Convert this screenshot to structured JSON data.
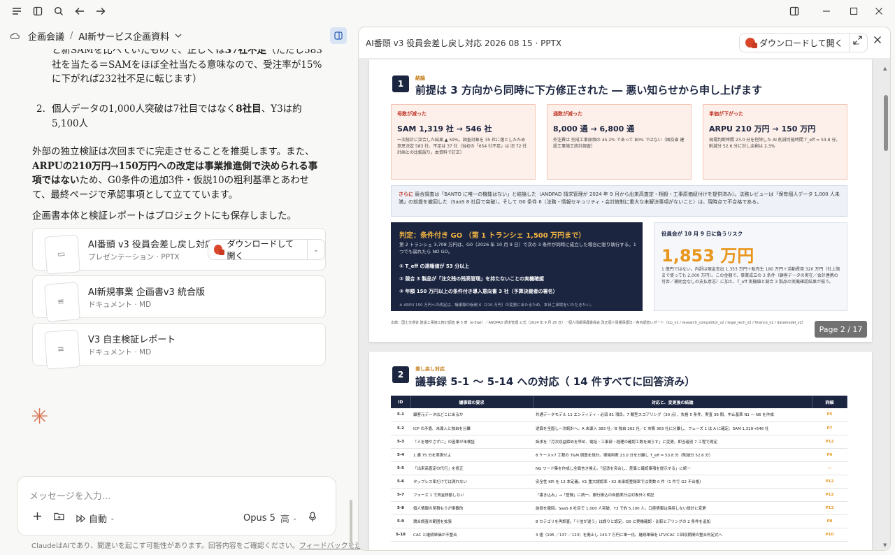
{
  "header": {
    "project": "企画会議",
    "conversation": "AI新サービス企画資料"
  },
  "message": {
    "p1_line1": "と新SAMを比べていたもので、正しくは",
    "p1_bold1": "37社不足",
    "p1_rest": "（ただし583社を当たる＝SAMをほぼ全社当たる意味なので、受注率が15%に下がれば232社不足に転じます）",
    "p2_num": "2.",
    "p2_a": "個人データの1,000人突破は7社目ではなく",
    "p2_bold": "8社目",
    "p2_b": "、Y3は約5,100人",
    "p3_a": "外部の独立検証は次回までに完走させることを推奨します。また、",
    "p3_bold": "ARPUの210万円→150万円への改定は事業推進側で決められる事項ではない",
    "p3_b": "ため、G0条件の追加3件・仮説10の粗利基準とあわせて、最終ページで承認事項として立てています。",
    "p4": "企画書本体と検証レポートはプロジェクトにも保存しました。"
  },
  "attachments": [
    {
      "title": "AI番頭 v3 役員会差し戻し対応...",
      "sub": "プレゼンテーション · PPTX"
    },
    {
      "title": "AI新規事業 企画書v3 統合版",
      "sub": "ドキュメント · MD"
    },
    {
      "title": "V3 自主検証レポート",
      "sub": "ドキュメント · MD"
    }
  ],
  "download_label": "ダウンロードして開く",
  "composer": {
    "placeholder": "メッセージを入力...",
    "mode": "自動",
    "model": "Opus 5",
    "effort": "高"
  },
  "footer": {
    "text": "ClaudeはAIであり、間違いを起こす可能性があります。回答内容をご確認ください。",
    "link": "フィードバックを送信"
  },
  "viewer": {
    "title": "AI番頭 v3 役員会差し戻し対応 2026 08 15 · PPTX",
    "page_badge": "Page 2 / 17"
  },
  "slide1": {
    "num": "1",
    "tag": "結論",
    "title": "前提は 3 方向から同時に下方修正された ― 悪い知らせから申し上げます",
    "boxes": [
      {
        "h": "母数が減った",
        "big": "SAM 1,319 社 → 546 社",
        "sm": "一次統計に突合した結果 ▲ 59%。調査対象を 35 社に落としたため 意思決定 583 社、不足は 37 社（当初の「654 社不足」は 旧 72 社 計画との比較誤り。本資料で訂正）"
      },
      {
        "h": "通数が減った",
        "big": "8,000 通 → 6,800 通",
        "sm": "外注費は 完成工事原価の 45.2% であって 80% ではない（国交省 建設工事施工統計調査）"
      },
      {
        "h": "単価が下がった",
        "big": "ARPU 210 万円 → 150 万円",
        "sm": "現場判断時間 23.0 分を控除した AI 削減可能時間 T_eff = 53.8 分。削減分 52.6 分に対し余剰は 2.3%"
      }
    ],
    "blue_red": "さらに",
    "blue_text": "競合調査は「BANTO に唯一の機能はない」と結論した（ANDPAD 請求管理が 2024 年 9 月から出来高査定・相殺・工事原価紐付けを提供済み）。法務レビューは「保有個人データ 1,000 人未満」の前提を撤回した（SaaS 8 社目で突破）。そして G0 条件 6（法務・情報セキュリティ・会計統制に重大な未解決事項がないこと）は、現時点で不合格である。",
    "navy_h": "判定：条件付き GO （第 1 トランシェ 1,500 万円まで）",
    "navy_sub": "第 2 トランシェ 3,708 万円は、G0（2026 年 10 月 9 日）で次の 3 条件が同時に成立した場合に限り執行する。1 つでも崩れたら NO GO。",
    "navy_items": [
      "① T_eff の達報値が 53 分以上",
      "② 競合 3 製品が「注文残の残高管理」を持たないことの実機確認",
      "③ 年額 150 万円以上の条件付き導入意向書 3 社（予算決裁者の署名）"
    ],
    "navy_foot": "※ ARPU 150 万円への改定は、議事録の仮説 6（210 万円）の変更にあたるため、本日ご承認をいただきたい。",
    "risk_h": "役員会が 10 月 9 日に負うリスク",
    "risk_big": "1,853 万円",
    "risk_sm": "1 億円ではない。内訳は現金支出 1,353 万円＋販売生 180 万円＋活動費用 320 万円（社上限まで使っても 2,000 万円）。この金額で、事業成立の 3 条件（顧客データの実在／会計連携の可否／補助金なしの支払意志）に加え、T_eff 実機値と競合 3 製品の実機確認結果が揃う。",
    "src": "出典：国土交通省 建設工事施工統計調査 第 5 表（e-Stat）／ANDPAD 請求管理 公式（2024 年 9 月 26 日）／個人情報保護委員会 改正個人情報保護法／各内調査レポート（icp_v2 / research_competitor_v2 / legal_tech_v2 / finance_v2 / datamodel_v2）"
  },
  "slide2": {
    "num": "2",
    "tag": "差し戻し対応",
    "title": "議事録 5-1 ～ 5-14 への対応（ 14 件すべてに回答済み）",
    "headers": [
      "ID",
      "議事録の要求",
      "対応と、変更後の結論",
      "詳細"
    ],
    "rows": [
      [
        "5-1",
        "顧客元データはどこにあるか",
        "共通データモデル 11 エンティティ・必須 81 項目。7 類型スコアリング（30 点）、失格 5 条件、実査 36 問、中止基準 N1 〜 N6 を作成",
        "P5"
      ],
      [
        "5-2",
        "ICP の矛盾、未導入と独自を分離",
        "逆算を全国し一次統計へ。A 未導入 383 社／B 独自 262 社／C 市販 363 社に分離し、フェーズ 1 は A に確定。SAM 1,319→546 社",
        "P7"
      ],
      [
        "5-3",
        "「人を増やさずに」の因果が未検証",
        "訴求を「月次収益締めを早め、電話・工事部・経理の確認工数を減らす」に変更。即当者別 7 工程で測定",
        "P12"
      ],
      [
        "5-4",
        "1 通 75 分を実測せよ",
        "8 ケース×7 工程の T&M 調査を設計。現場判断 23.0 分を分離し T_eff = 53.8 分（削減分 52.6 分）",
        "P6"
      ],
      [
        "5-5",
        "「出来高査定の代行」を修正",
        "NG ワード集を作成し全面言き換え。「証憑を突合し、差異と確認事項を提示する」に統一",
        "—"
      ],
      [
        "5-6",
        "タップレス率だけでは測れない",
        "安全性 KPI を 12 本定義。K1 重大誤認率・K2 未承認登録率では実数 0 件（1 件で G2 不合格）",
        "P12"
      ],
      [
        "5-7",
        "フェーズ 1 で資金移動しない",
        "「書き込み」→「登録」に統一。銀行振込の自動実行は対象外と明記",
        "P12"
      ],
      [
        "5-8",
        "個人情報の見積もりが楽観的",
        "前提を撤回。SaaS 8 社目で 1,000 人突破、Y3 で約 5,100 人。口座情報は保持しない設計に変更",
        "P13"
      ],
      [
        "5-9",
        "競合調査の範囲を拡張",
        "8 カテゴリを再調査。「十並が違う」は誤りと認定。G0 に実機確認・比較ヒアリングの 2 条件を追加",
        "P8"
      ],
      [
        "5-10",
        "CAC と継続単価が不整合",
        "3 値（195 ／137 ／123）を廃止し 143.7 万円に単一化。継続単価を LTV/CAC と回収期間の整合判定式へ",
        "P10"
      ]
    ]
  }
}
